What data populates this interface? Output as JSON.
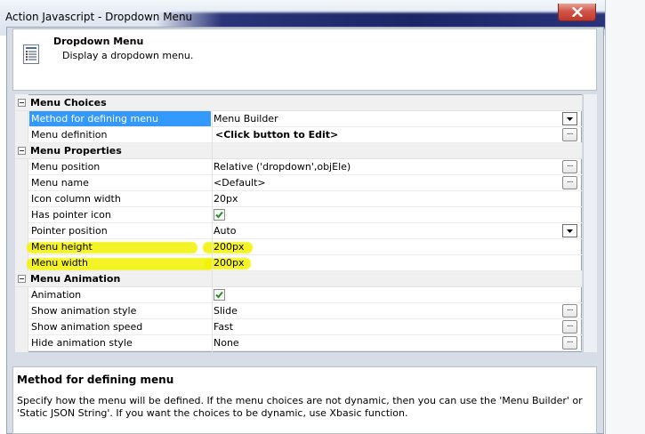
{
  "window": {
    "title": "Action Javascript - Dropdown Menu"
  },
  "header": {
    "title": "Dropdown Menu",
    "subtitle": "Display a dropdown menu."
  },
  "categories": {
    "menu_choices": "Menu Choices",
    "menu_properties": "Menu Properties",
    "menu_animation": "Menu Animation"
  },
  "properties": {
    "method": {
      "name": "Method for defining menu",
      "value": "Menu Builder"
    },
    "definition": {
      "name": "Menu definition",
      "value": "<Click button to Edit>"
    },
    "position": {
      "name": "Menu position",
      "value": "Relative ('dropdown',objEle)"
    },
    "menu_name": {
      "name": "Menu name",
      "value": "<Default>"
    },
    "icon_width": {
      "name": "Icon column width",
      "value": "20px"
    },
    "pointer_icon": {
      "name": "Has pointer icon",
      "checked": true
    },
    "pointer_position": {
      "name": "Pointer position",
      "value": "Auto"
    },
    "menu_height": {
      "name": "Menu height",
      "value": "200px"
    },
    "menu_width": {
      "name": "Menu width",
      "value": "200px"
    },
    "animation": {
      "name": "Animation",
      "checked": true
    },
    "show_style": {
      "name": "Show animation style",
      "value": "Slide"
    },
    "show_speed": {
      "name": "Show animation speed",
      "value": "Fast"
    },
    "hide_style": {
      "name": "Hide animation style",
      "value": "None"
    }
  },
  "buttons": {
    "ellipsis": "..."
  },
  "description": {
    "title": "Method for defining menu",
    "text": "Specify how the menu will be defined. If the menu choices are not dynamic, then you can use the 'Menu Builder' or 'Static JSON String'. If you want the choices to be dynamic, use Xbasic function."
  },
  "colors": {
    "selection": "#3399ff",
    "highlight": "#f2f200",
    "close": "#c0382c"
  }
}
